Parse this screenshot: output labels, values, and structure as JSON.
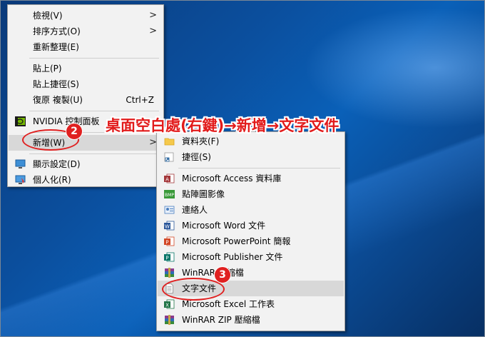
{
  "annotation": {
    "text": "桌面空白處(右鍵)→新增→文字文件",
    "step2": "2",
    "step3": "3"
  },
  "context_menu": {
    "items": [
      {
        "label": "檢視(V)"
      },
      {
        "label": "排序方式(O)"
      },
      {
        "label": "重新整理(E)"
      },
      {
        "label": "貼上(P)"
      },
      {
        "label": "貼上捷徑(S)"
      },
      {
        "label": "復原 複製(U)",
        "shortcut": "Ctrl+Z"
      },
      {
        "label": "NVIDIA 控制面板"
      },
      {
        "label": "新增(W)"
      },
      {
        "label": "顯示設定(D)"
      },
      {
        "label": "個人化(R)"
      }
    ]
  },
  "new_submenu": {
    "items": [
      {
        "label": "資料夾(F)",
        "icon": "folder-icon"
      },
      {
        "label": "捷徑(S)",
        "icon": "shortcut-icon"
      },
      {
        "label": "Microsoft Access 資料庫",
        "icon": "access-icon"
      },
      {
        "label": "點陣圖影像",
        "icon": "bitmap-icon"
      },
      {
        "label": "連絡人",
        "icon": "contact-icon"
      },
      {
        "label": "Microsoft Word 文件",
        "icon": "word-icon"
      },
      {
        "label": "Microsoft PowerPoint 簡報",
        "icon": "powerpoint-icon"
      },
      {
        "label": "Microsoft Publisher 文件",
        "icon": "publisher-icon"
      },
      {
        "label": "WinRAR 壓縮檔",
        "icon": "winrar-icon"
      },
      {
        "label": "文字文件",
        "icon": "text-document-icon"
      },
      {
        "label": "Microsoft Excel 工作表",
        "icon": "excel-icon"
      },
      {
        "label": "WinRAR ZIP 壓縮檔",
        "icon": "winrar-zip-icon"
      }
    ]
  }
}
